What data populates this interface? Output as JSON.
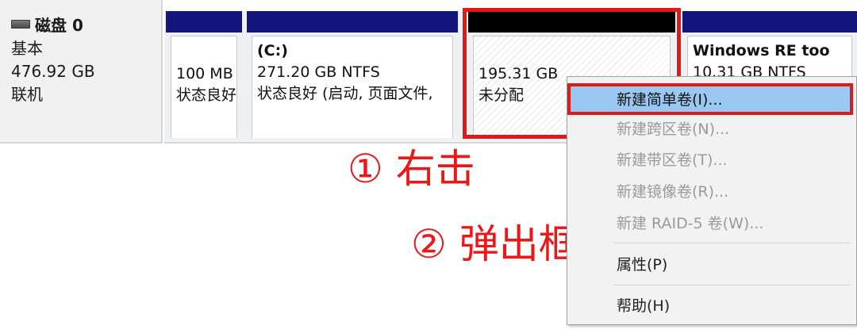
{
  "disk": {
    "title": "磁盘 0",
    "type": "基本",
    "size": "476.92 GB",
    "status": "联机"
  },
  "partitions": [
    {
      "line1": "",
      "line2": "100 MB",
      "line3": "状态良好"
    },
    {
      "line1": "(C:)",
      "line2": "271.20 GB NTFS",
      "line3": "状态良好 (启动, 页面文件,"
    },
    {
      "line1": "",
      "line2": "195.31 GB",
      "line3": "未分配"
    },
    {
      "line1": "Windows RE too",
      "line2": "10.31 GB NTFS",
      "line3": ""
    }
  ],
  "annotations": {
    "step1": "① 右击",
    "step2": "② 弹出框"
  },
  "context_menu": {
    "items": [
      {
        "label": "新建简单卷(I)...",
        "state": "selected"
      },
      {
        "label": "新建跨区卷(N)...",
        "state": "disabled"
      },
      {
        "label": "新建带区卷(T)...",
        "state": "disabled"
      },
      {
        "label": "新建镜像卷(R)...",
        "state": "disabled"
      },
      {
        "label": "新建 RAID-5 卷(W)...",
        "state": "disabled"
      },
      {
        "label": "属性(P)",
        "state": "enabled"
      },
      {
        "label": "帮助(H)",
        "state": "enabled"
      }
    ]
  },
  "colors": {
    "partition_bar": "#13147c",
    "unallocated_bar": "#000000",
    "highlight": "#e01a1a",
    "menu_selected": "#99c9f3"
  }
}
